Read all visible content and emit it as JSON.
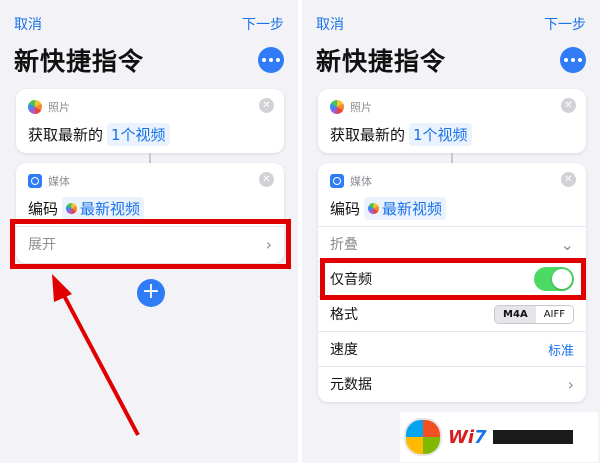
{
  "left": {
    "cancel": "取消",
    "next": "下一步",
    "title": "新快捷指令",
    "card1": {
      "app": "照片",
      "prefix": "获取最新的",
      "token": "1个视频"
    },
    "card2": {
      "app": "媒体",
      "prefix": "编码",
      "token": "最新视频",
      "expand": "展开"
    }
  },
  "right": {
    "cancel": "取消",
    "next": "下一步",
    "title": "新快捷指令",
    "card1": {
      "app": "照片",
      "prefix": "获取最新的",
      "token": "1个视频"
    },
    "card2": {
      "app": "媒体",
      "prefix": "编码",
      "token": "最新视频",
      "collapse": "折叠",
      "audio_only": {
        "label": "仅音频",
        "on": true
      },
      "format": {
        "label": "格式",
        "options": [
          "M4A",
          "AIFF"
        ],
        "selected": "M4A"
      },
      "speed": {
        "label": "速度",
        "value": "标准"
      },
      "metadata": {
        "label": "元数据"
      }
    }
  },
  "watermark": {
    "text_win": "Wi",
    "text_7": "7"
  },
  "colors": {
    "accent": "#1a73e8",
    "highlight": "#e00000",
    "toggle_on": "#4cd964"
  }
}
